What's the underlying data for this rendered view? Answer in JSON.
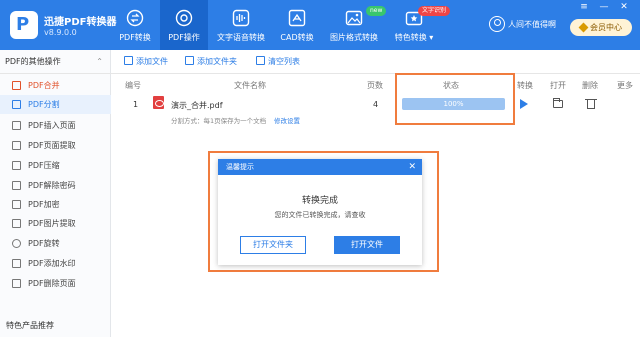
{
  "app": {
    "name": "迅捷PDF转换器",
    "version": "v8.9.0.0",
    "logo_letter": "P"
  },
  "nav": [
    {
      "label": "PDF转换",
      "icon": "convert-icon"
    },
    {
      "label": "PDF操作",
      "icon": "pdf-operation-icon",
      "active": true
    },
    {
      "label": "文字语音转换",
      "icon": "audio-wave-icon"
    },
    {
      "label": "CAD转换",
      "icon": "cad-icon"
    },
    {
      "label": "图片格式转换",
      "icon": "image-icon",
      "badge": "new"
    },
    {
      "label": "特色转换",
      "icon": "special-convert-icon",
      "badge": "文字识别",
      "chevron": "▾"
    }
  ],
  "user": {
    "name": "人间不值得啊",
    "member_label": "会员中心"
  },
  "window_controls": {
    "menu": "≡",
    "minimize": "—",
    "close": "✕"
  },
  "colors": {
    "primary": "#2d7ee6",
    "highlight": "#f07c3e",
    "badge_green": "#39c66d",
    "badge_red": "#ef4545"
  },
  "sidebar": {
    "header": "PDF的其他操作",
    "chevron": "⌃",
    "items": [
      {
        "label": "PDF合并",
        "icon": "merge-icon"
      },
      {
        "label": "PDF分割",
        "icon": "split-icon",
        "selected": true
      },
      {
        "label": "PDF插入页面",
        "icon": "insert-page-icon"
      },
      {
        "label": "PDF页面提取",
        "icon": "extract-page-icon"
      },
      {
        "label": "PDF压缩",
        "icon": "compress-icon"
      },
      {
        "label": "PDF解除密码",
        "icon": "unlock-icon"
      },
      {
        "label": "PDF加密",
        "icon": "lock-icon"
      },
      {
        "label": "PDF图片提取",
        "icon": "image-extract-icon"
      },
      {
        "label": "PDF旋转",
        "icon": "rotate-icon"
      },
      {
        "label": "PDF添加水印",
        "icon": "watermark-icon"
      },
      {
        "label": "PDF删除页面",
        "icon": "delete-page-icon"
      }
    ],
    "footer": "特色产品推荐"
  },
  "toolbar": {
    "add_file": "添加文件",
    "add_folder": "添加文件夹",
    "clear_list": "清空列表"
  },
  "table": {
    "headers": {
      "index": "编号",
      "filename": "文件名称",
      "pages": "页数",
      "status": "状态",
      "convert": "转换",
      "open": "打开",
      "delete": "删除",
      "more": "更多"
    },
    "rows": [
      {
        "index": "1",
        "filename": "演示_合并.pdf",
        "split_mode": "分割方式：每1页保存为一个文档",
        "modify_settings": "修改设置",
        "pages": "4",
        "progress_percent": 100,
        "progress_text": "100%"
      }
    ]
  },
  "dialog": {
    "header": "温馨提示",
    "close": "✕",
    "title": "转换完成",
    "message": "您的文件已转换完成，请查收",
    "open_folder": "打开文件夹",
    "open_file": "打开文件"
  }
}
